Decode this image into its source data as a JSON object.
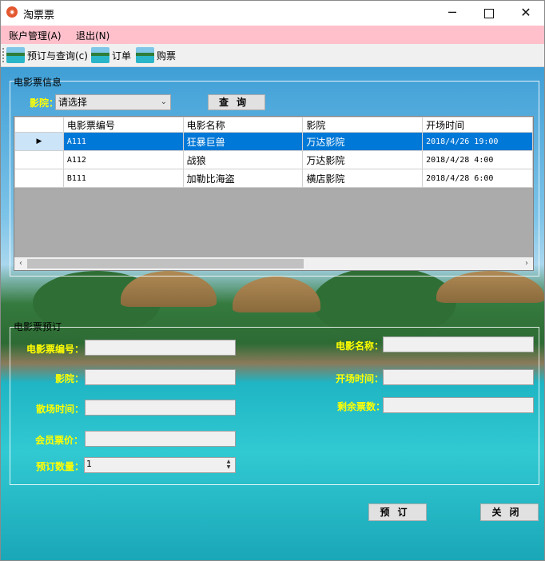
{
  "window": {
    "title": "淘票票",
    "controls": {
      "minimize": "─",
      "close": "✕"
    }
  },
  "menu": [
    {
      "label": "账户管理(A)"
    },
    {
      "label": "退出(N)"
    }
  ],
  "toolbar": [
    {
      "label": "预订与查询(c)"
    },
    {
      "label": "订单"
    },
    {
      "label": "购票"
    }
  ],
  "info": {
    "group_title": "电影票信息",
    "cinema_label": "影院：",
    "cinema_value": "请选择",
    "query_button": "查询",
    "columns": [
      "电影票编号",
      "电影名称",
      "影院",
      "开场时间"
    ],
    "rows": [
      {
        "id": "A111",
        "name": "狂暴巨兽",
        "cinema": "万达影院",
        "time": "2018/4/26 19:00"
      },
      {
        "id": "A112",
        "name": "战狼",
        "cinema": "万达影院",
        "time": "2018/4/28 4:00"
      },
      {
        "id": "B111",
        "name": "加勒比海盗",
        "cinema": "横店影院",
        "time": "2018/4/28 6:00"
      }
    ]
  },
  "booking": {
    "group_title": "电影票预订",
    "ticket_no_label": "电影票编号：",
    "movie_name_label": "电影名称：",
    "cinema_label": "影院：",
    "start_time_label": "开场时间：",
    "end_time_label": "散场时间：",
    "remaining_label": "剩余票数：",
    "member_price_label": "会员票价：",
    "quantity_label": "预订数量：",
    "quantity_value": "1",
    "book_button": "预订",
    "close_button": "关闭"
  }
}
